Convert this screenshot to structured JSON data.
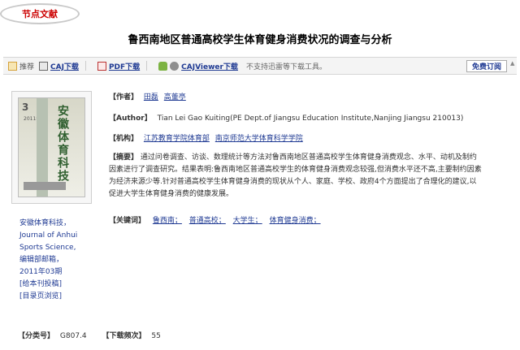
{
  "tag": {
    "label": "节点文献"
  },
  "title": "鲁西南地区普通高校学生体育健身消费状况的调查与分析",
  "toolbar": {
    "recommend": "推荐",
    "caj_download": "CAJ下载",
    "pdf_download": "PDF下载",
    "cajviewer_download": "CAJViewer下载",
    "note": "不支持迅雷等下载工具。",
    "subscribe": "免费订阅"
  },
  "journal": {
    "cover_number": "3",
    "cover_year": "2011年",
    "cover_title": "安徽体育科技",
    "info_lines": [
      "安徽体育科技，",
      "Journal of Anhui",
      "Sports Science,",
      "编辑部邮箱，",
      "2011年03期",
      "[给本刊投稿]",
      "[目录页浏览]"
    ]
  },
  "authors": {
    "label": "【作者】",
    "names": [
      "田磊",
      "高董亭"
    ]
  },
  "author_en": {
    "label": "【Author】",
    "text": "Tian Lei Gao Kuiting(PE Dept.of Jiangsu Education Institute,Nanjing Jiangsu 210013)"
  },
  "institutions": {
    "label": "【机构】",
    "items": [
      "江苏教育学院体育部",
      "南京师范大学体育科学学院"
    ]
  },
  "abstract": {
    "label": "【摘要】",
    "lines": [
      "通过问卷调查、访谈、数理统计等方法对鲁西南地区普通高校学生体育健身消费观念、水平、动机及制约",
      "因素进行了调查研究。结果表明:鲁西南地区普通高校学生的体育健身消费观念较强,但消费水平还不高,主要制约因素",
      "为经济来源少等.针对普通高校学生体育健身消费的现状从个人、家庭、学校、政府4个方面提出了合理化的建议,以",
      "促进大学生体育健身消费的健康发展。"
    ]
  },
  "keywords": {
    "label": "【关键词】",
    "items": [
      "鲁西南；",
      "普通高校；",
      "大学生；",
      "体育健身消费；"
    ]
  },
  "classification": {
    "label": "【分类号】",
    "value": "G807.4"
  },
  "downloads": {
    "label": "【下载频次】",
    "value": "55"
  }
}
